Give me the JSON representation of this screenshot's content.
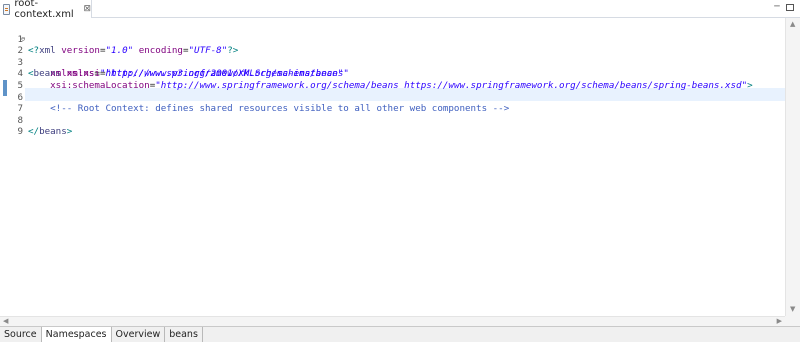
{
  "editor_tab": {
    "file_name": "root-context.xml",
    "close_glyph": "⊠"
  },
  "window_controls": {
    "minimize_glyph": "─"
  },
  "lines": [
    {
      "num": "1"
    },
    {
      "num": "2",
      "fold": "⊖"
    },
    {
      "num": "3"
    },
    {
      "num": "4"
    },
    {
      "num": "5"
    },
    {
      "num": "6"
    },
    {
      "num": "7"
    },
    {
      "num": "8"
    },
    {
      "num": "9"
    }
  ],
  "code": {
    "l1": {
      "open": "<?",
      "tag": "xml",
      "attr1": " version",
      "eq1": "=",
      "val1": "\"1.0\"",
      "attr2": " encoding",
      "eq2": "=",
      "val2": "\"UTF-8\"",
      "close": "?>"
    },
    "l2": {
      "open": "<",
      "tag": "beans",
      "attr": " xmlns",
      "eq": "=",
      "val": "\"http://www.springframework.org/schema/beans\""
    },
    "l3": {
      "indent": "    ",
      "attr": "xmlns:xsi",
      "eq": "=",
      "val": "\"http://www.w3.org/2001/XMLSchema-instance\""
    },
    "l4": {
      "indent": "    ",
      "attr": "xsi:schemaLocation",
      "eq": "=",
      "val": "\"http://www.springframework.org/schema/beans https://www.springframework.org/schema/beans/spring-beans.xsd\"",
      "close": ">"
    },
    "l6": {
      "indent": "    ",
      "comment": "<!-- Root Context: defines shared resources visible to all other web components -->"
    },
    "l8": {
      "open": "</",
      "tag": "beans",
      "close": ">"
    }
  },
  "scroll": {
    "up": "▲",
    "down": "▼",
    "left": "◀",
    "right": "▶"
  },
  "page_tabs": [
    {
      "label": "Source"
    },
    {
      "label": "Namespaces"
    },
    {
      "label": "Overview"
    },
    {
      "label": "beans"
    }
  ]
}
